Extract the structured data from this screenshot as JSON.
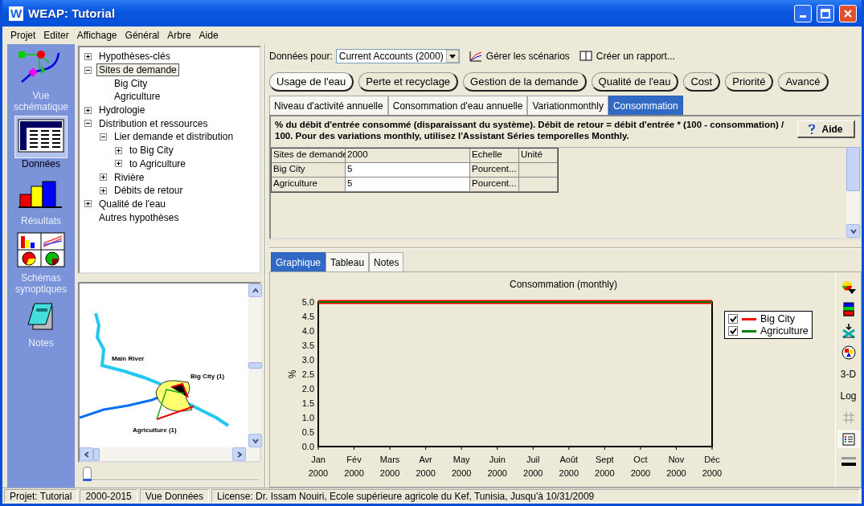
{
  "window": {
    "icon_letter": "W",
    "title": "WEAP: Tutorial"
  },
  "menu": [
    "Projet",
    "Editer",
    "Affichage",
    "Général",
    "Arbre",
    "Aide"
  ],
  "views": [
    {
      "label": "Vue schématique",
      "selected": false
    },
    {
      "label": "Données",
      "selected": true
    },
    {
      "label": "Résultats",
      "selected": false
    },
    {
      "label": "Schémas synoptiques",
      "selected": false
    },
    {
      "label": "Notes",
      "selected": false
    }
  ],
  "tree": [
    {
      "label": "Hypothèses-clés",
      "expanded": false,
      "selected": false
    },
    {
      "label": "Sites de demande",
      "expanded": true,
      "selected": true,
      "children": [
        {
          "label": "Big City",
          "selected": false
        },
        {
          "label": "Agriculture",
          "selected": false
        }
      ]
    },
    {
      "label": "Hydrologie",
      "expanded": false,
      "selected": false
    },
    {
      "label": "Distribution et ressources",
      "expanded": true,
      "selected": false,
      "children": [
        {
          "label": "Lier demande et distribution",
          "expanded": true,
          "selected": false,
          "children": [
            {
              "label": "to Big City",
              "expanded": false,
              "selected": false
            },
            {
              "label": "to Agriculture",
              "expanded": false,
              "selected": false
            }
          ]
        },
        {
          "label": "Rivière",
          "expanded": false,
          "selected": false
        },
        {
          "label": "Débits de retour",
          "expanded": false,
          "selected": false
        }
      ]
    },
    {
      "label": "Qualité de l'eau",
      "expanded": false,
      "selected": false
    },
    {
      "label": "Autres hypothèses",
      "selected": false
    }
  ],
  "map": {
    "labels": [
      "Main River",
      "Big City (1)",
      "Agriculture (1)"
    ]
  },
  "timeline_slider": {
    "level": 0
  },
  "toolbar": {
    "data_for_label": "Données pour:",
    "scenario": "Current Accounts (2000)",
    "links": [
      "Gérer les scénarios",
      "Créer un rapport..."
    ]
  },
  "categories": [
    {
      "label": "Usage de l'eau",
      "selected": true
    },
    {
      "label": "Perte et recyclage",
      "selected": false
    },
    {
      "label": "Gestion de la demande",
      "selected": false
    },
    {
      "label": "Qualité de l'eau",
      "selected": false
    },
    {
      "label": "Cost",
      "selected": false
    },
    {
      "label": "Priorité",
      "selected": false
    },
    {
      "label": "Avancé",
      "selected": false
    }
  ],
  "subtabs": [
    {
      "label": "Niveau d'activité annuelle",
      "selected": false
    },
    {
      "label": "Consommation d'eau annuelle",
      "selected": false
    },
    {
      "label": "Variationmonthly",
      "selected": false
    },
    {
      "label": "Consommation",
      "selected": true
    }
  ],
  "description": "% du débit d'entrée consommé (disparaissant du système). Débit de retour = débit d'entrée * (100 - consommation) / 100.  Pour des variations monthly, utilisez l'Assistant Séries temporelles Monthly.",
  "help_button": "Aide",
  "table": {
    "columns": [
      "Sites de demande",
      "2000",
      "Echelle",
      "Unité"
    ],
    "rows": [
      [
        "Big City",
        "5",
        "Pourcent...",
        ""
      ],
      [
        "Agriculture",
        "5",
        "Pourcent...",
        ""
      ]
    ]
  },
  "result_tabs": [
    {
      "label": "Graphique",
      "selected": true
    },
    {
      "label": "Tableau",
      "selected": false
    },
    {
      "label": "Notes",
      "selected": false
    }
  ],
  "chart": {
    "chart_data": {
      "type": "line",
      "title": "Consommation (monthly)",
      "ylabel": "%",
      "categories": [
        "Jan 2000",
        "Fév 2000",
        "Mars 2000",
        "Avr 2000",
        "May 2000",
        "Juin 2000",
        "Juil 2000",
        "Août 2000",
        "Sept 2000",
        "Oct 2000",
        "Nov 2000",
        "Déc 2000"
      ],
      "series": [
        {
          "name": "Big City",
          "color": "#ff0000",
          "values": [
            5,
            5,
            5,
            5,
            5,
            5,
            5,
            5,
            5,
            5,
            5,
            5
          ]
        },
        {
          "name": "Agriculture",
          "color": "#008000",
          "values": [
            5,
            5,
            5,
            5,
            5,
            5,
            5,
            5,
            5,
            5,
            5,
            5
          ]
        }
      ],
      "ylim": [
        0,
        5
      ],
      "yticks": [
        {
          "value": 0,
          "label": "0.0"
        },
        {
          "value": 0.5,
          "label": "0.5"
        },
        {
          "value": 1,
          "label": "1.0"
        },
        {
          "value": 1.5,
          "label": "1.5"
        },
        {
          "value": 2,
          "label": "2.0"
        },
        {
          "value": 2.5,
          "label": "2.5"
        },
        {
          "value": 3,
          "label": "3.0"
        },
        {
          "value": 3.5,
          "label": "3.5"
        },
        {
          "value": 4,
          "label": "4.0"
        },
        {
          "value": 4.5,
          "label": "4.5"
        },
        {
          "value": 5,
          "label": "5.0"
        }
      ]
    },
    "legend": [
      {
        "checked": true
      },
      {
        "checked": true
      }
    ],
    "tool_labels": [
      "3-D",
      "Log"
    ],
    "legend_toggle_pressed": true
  },
  "status_bar": [
    "Projet: Tutorial",
    "2000-2015",
    "Vue Données",
    "License: Dr. Issam Nouiri, Ecole supérieure agricole du Kef, Tunisia, Jusqu'à 10/31/2009"
  ]
}
